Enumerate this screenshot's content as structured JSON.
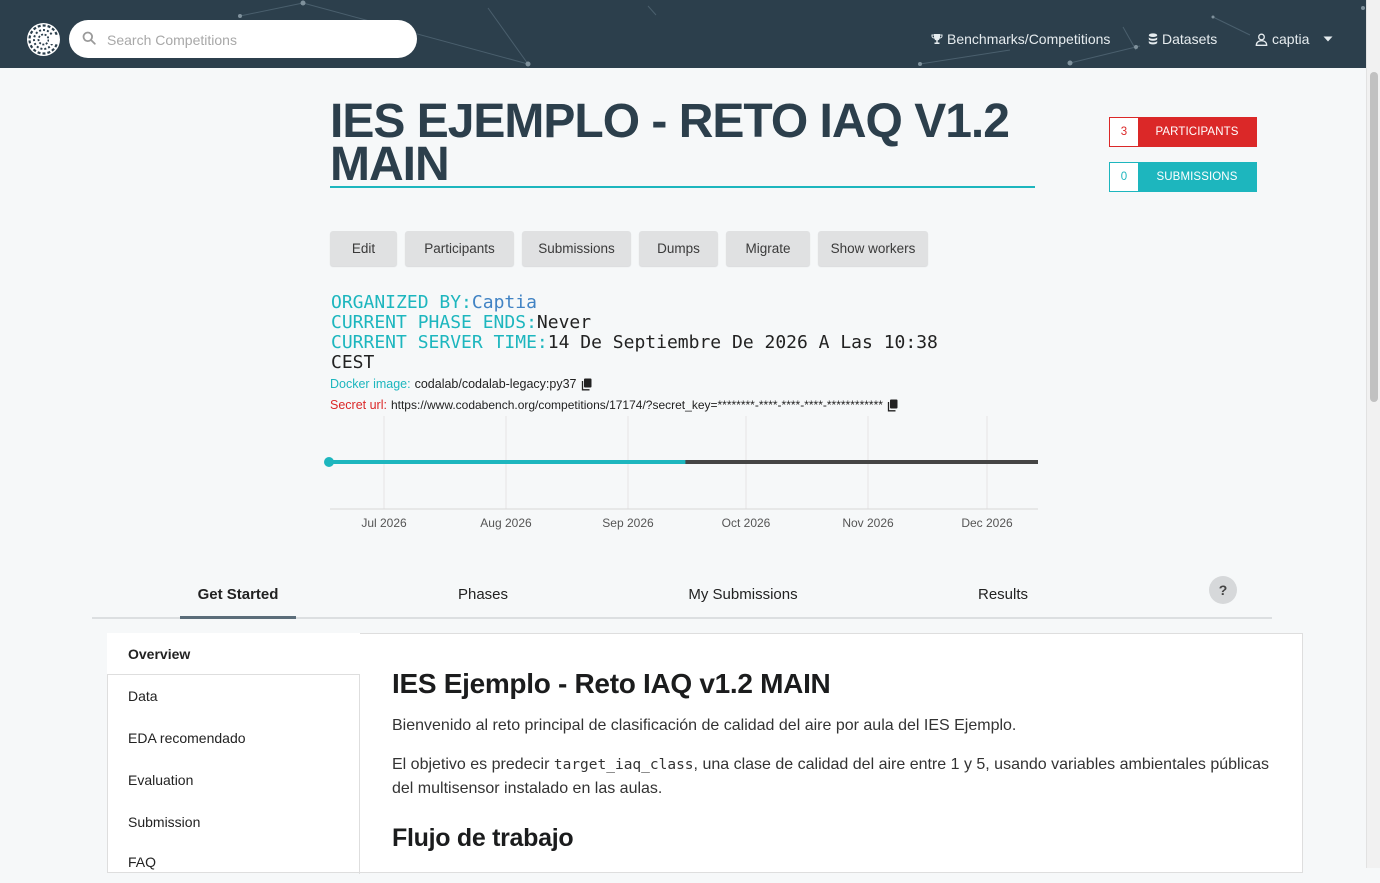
{
  "navbar": {
    "search_placeholder": "Search Competitions",
    "benchmarks_label": "Benchmarks/Competitions",
    "datasets_label": "Datasets",
    "user_label": "captia"
  },
  "competition": {
    "title": "IES EJEMPLO - RETO IAQ V1.2 MAIN",
    "participants_count": "3",
    "participants_label": "PARTICIPANTS",
    "submissions_count": "0",
    "submissions_label": "SUBMISSIONS"
  },
  "actions": {
    "edit": "Edit",
    "participants": "Participants",
    "submissions": "Submissions",
    "dumps": "Dumps",
    "migrate": "Migrate",
    "show_workers": "Show workers"
  },
  "info": {
    "organized_by_label": "ORGANIZED BY:",
    "organized_by_value": "Captia",
    "phase_ends_label": "CURRENT PHASE ENDS:",
    "phase_ends_value": "Never",
    "server_time_label": "CURRENT SERVER TIME:",
    "server_time_value_line1": "14 De Septiembre De 2026 A Las 10:38",
    "server_time_value_line2": "CEST",
    "docker_label": "Docker image:",
    "docker_value": "codalab/codalab-legacy:py37",
    "secret_label": "Secret url:",
    "secret_value": "https://www.codabench.org/competitions/17174/?secret_key=********-****-****-****-************"
  },
  "timeline": {
    "months": [
      "Jul 2026",
      "Aug 2026",
      "Sep 2026",
      "Oct 2026",
      "Nov 2026",
      "Dec 2026"
    ],
    "progress_fraction": 0.502,
    "completed_color": "#1db6be",
    "remaining_color": "#454545"
  },
  "tabs": {
    "get_started": "Get Started",
    "phases": "Phases",
    "my_submissions": "My Submissions",
    "results": "Results",
    "help": "?"
  },
  "sidebar": {
    "items": [
      "Overview",
      "Data",
      "EDA recomendado",
      "Evaluation",
      "Submission",
      "FAQ"
    ]
  },
  "content": {
    "heading": "IES Ejemplo - Reto IAQ v1.2 MAIN",
    "intro": "Bienvenido al reto principal de clasificación de calidad del aire por aula del IES Ejemplo.",
    "objective_pre": "El objetivo es predecir ",
    "objective_code": "target_iaq_class",
    "objective_post": ", una clase de calidad del aire entre 1 y 5, usando variables ambientales públicas del multisensor instalado en las aulas.",
    "workflow_heading": "Flujo de trabajo"
  },
  "colors": {
    "navbar": "#2c3f4c",
    "accent_teal": "#1db6be",
    "accent_red": "#db2828"
  }
}
